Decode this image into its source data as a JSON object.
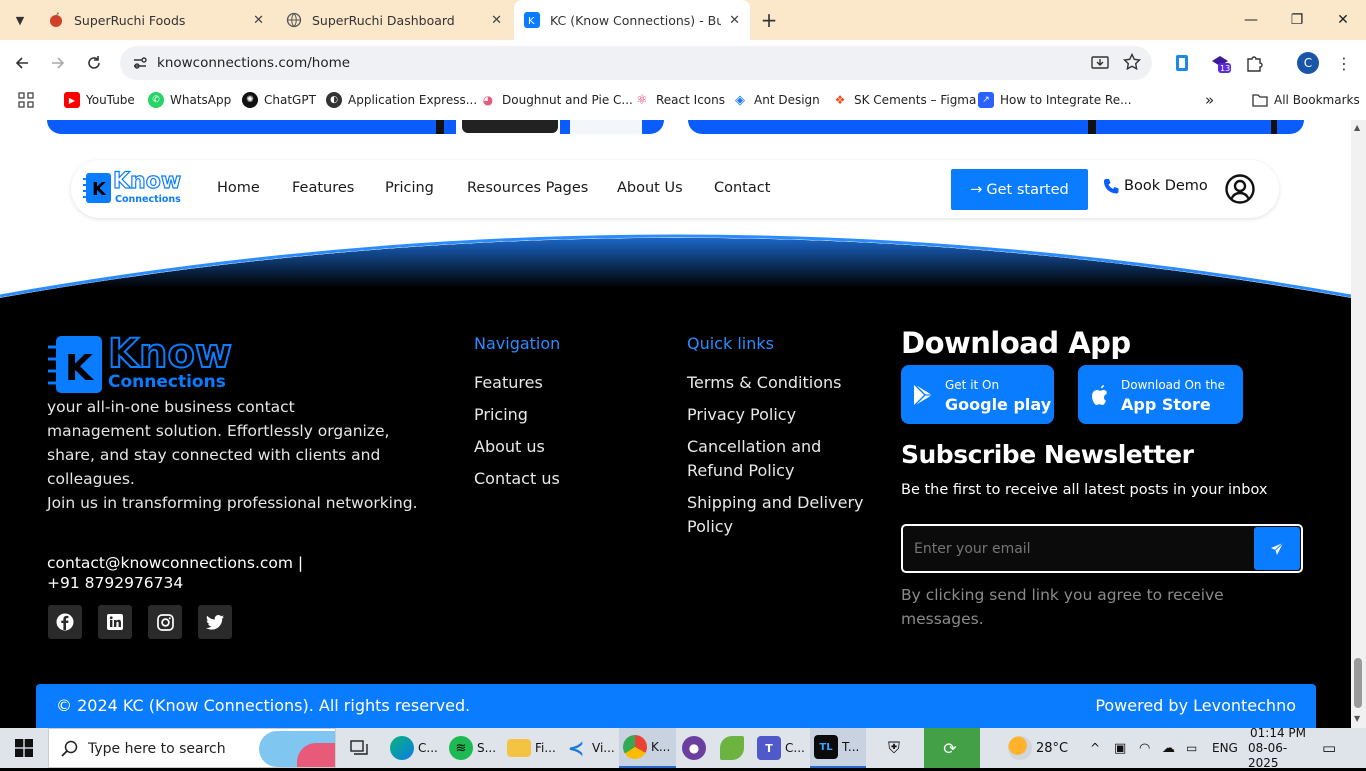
{
  "browser": {
    "tabs": [
      {
        "title": "SuperRuchi Foods",
        "close": "✕"
      },
      {
        "title": "SuperRuchi Dashboard",
        "close": "✕"
      },
      {
        "title": "KC (Know Connections) - Business",
        "close": "✕"
      }
    ],
    "new_tab": "+",
    "url": "knowconnections.com/home",
    "extension_badge": "13",
    "profile_initial": "C",
    "bookmarks": [
      "YouTube",
      "WhatsApp",
      "ChatGPT",
      "Application Express...",
      "Doughnut and Pie C...",
      "React Icons",
      "Ant Design",
      "SK Cements – Figma",
      "How to Integrate Re..."
    ],
    "all_bookmarks": "All Bookmarks",
    "more_bookmarks": "»"
  },
  "navbar": {
    "logo_know": "Know",
    "logo_connections": "Connections",
    "links": [
      "Home",
      "Features",
      "Pricing",
      "Resources Pages",
      "About Us",
      "Contact"
    ],
    "get_started": "Get started",
    "book_demo": "Book Demo"
  },
  "footer": {
    "logo_know": "Know",
    "logo_connections": "Connections",
    "about_lines": [
      "your all-in-one business contact",
      "management solution. Effortlessly organize,",
      "share, and stay connected with clients and",
      "colleagues.",
      "Join us in transforming professional networking."
    ],
    "contact_line1": "contact@knowconnections.com |",
    "contact_line2": "+91 8792976734",
    "navigation": {
      "heading": "Navigation",
      "links": [
        "Features",
        "Pricing",
        "About us",
        "Contact us"
      ]
    },
    "quick_links": {
      "heading": "Quick links",
      "links": [
        "Terms & Conditions",
        "Privacy Policy",
        "Cancellation and",
        "Refund Policy",
        "Shipping and Delivery",
        "Policy"
      ]
    },
    "download": {
      "heading": "Download App",
      "google_small": "Get it On",
      "google_big": "Google play",
      "apple_small": "Download On the",
      "apple_big": "App Store"
    },
    "newsletter": {
      "heading": "Subscribe Newsletter",
      "subtitle": "Be the first to receive all latest posts in your inbox",
      "placeholder": "Enter your email",
      "disclaimer_1": "By clicking send link you agree to receive",
      "disclaimer_2": "messages."
    },
    "copyright": "© 2024 KC (Know Connections). All rights reserved.",
    "powered_by": "Powered by Levontechno"
  },
  "taskbar": {
    "search_placeholder": "Type here to search",
    "apps": [
      "C...",
      "S...",
      "Fi...",
      "Vi...",
      "K...",
      "",
      "",
      "C...",
      "T..."
    ],
    "weather": "28°C",
    "lang": "ENG",
    "time": "01:14 PM",
    "date": "08-06-2025"
  }
}
